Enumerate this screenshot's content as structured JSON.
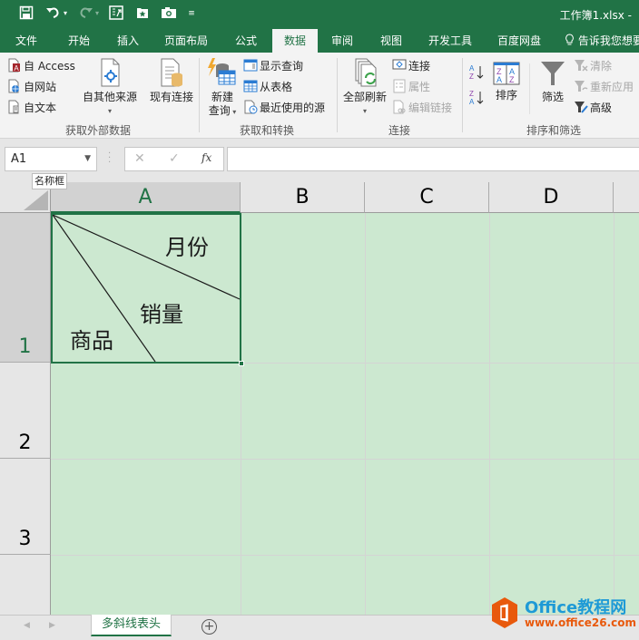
{
  "titlebar": {
    "title": "工作簿1.xlsx -",
    "qat": [
      "save-icon",
      "undo-icon",
      "redo-icon",
      "form-icon",
      "favorite-icon",
      "camera-icon",
      "customize-qat-icon"
    ]
  },
  "tabs": [
    {
      "label": "文件"
    },
    {
      "label": "开始"
    },
    {
      "label": "插入"
    },
    {
      "label": "页面布局"
    },
    {
      "label": "公式"
    },
    {
      "label": "数据",
      "active": true
    },
    {
      "label": "审阅"
    },
    {
      "label": "视图"
    },
    {
      "label": "开发工具"
    },
    {
      "label": "百度网盘"
    }
  ],
  "tell_me": "告诉我您想要",
  "ribbon": {
    "groups": {
      "external": {
        "label": "获取外部数据",
        "from_access": "自 Access",
        "from_web": "自网站",
        "from_text": "自文本",
        "from_other": "自其他来源",
        "existing": "现有连接"
      },
      "transform": {
        "label": "获取和转换",
        "new_query_1": "新建",
        "new_query_2": "查询",
        "show_queries": "显示查询",
        "from_table": "从表格",
        "recent_sources": "最近使用的源"
      },
      "connections": {
        "label": "连接",
        "refresh_all": "全部刷新",
        "connections": "连接",
        "properties": "属性",
        "edit_links": "编辑链接"
      },
      "sort_filter": {
        "label": "排序和筛选",
        "sort": "排序",
        "filter": "筛选",
        "clear": "清除",
        "reapply": "重新应用",
        "advanced": "高级",
        "sort_az": "AZ",
        "sort_za": "ZA"
      }
    }
  },
  "formula_bar": {
    "name_box": "A1",
    "name_box_tooltip": "名称框",
    "cancel": "✕",
    "enter": "✓",
    "fx": "fx",
    "content": ""
  },
  "grid": {
    "columns": [
      "A",
      "B",
      "C",
      "D"
    ],
    "rows": [
      "1",
      "2",
      "3"
    ],
    "selected_cell": "A1",
    "cell_a1": {
      "label_top_right": "月份",
      "label_middle": "销量",
      "label_bottom_left": "商品"
    }
  },
  "sheets": {
    "tabs": [
      "多斜线表头"
    ],
    "add_label": "+"
  },
  "watermark": {
    "brand": "Office教程网",
    "url": "www.office26.com"
  }
}
